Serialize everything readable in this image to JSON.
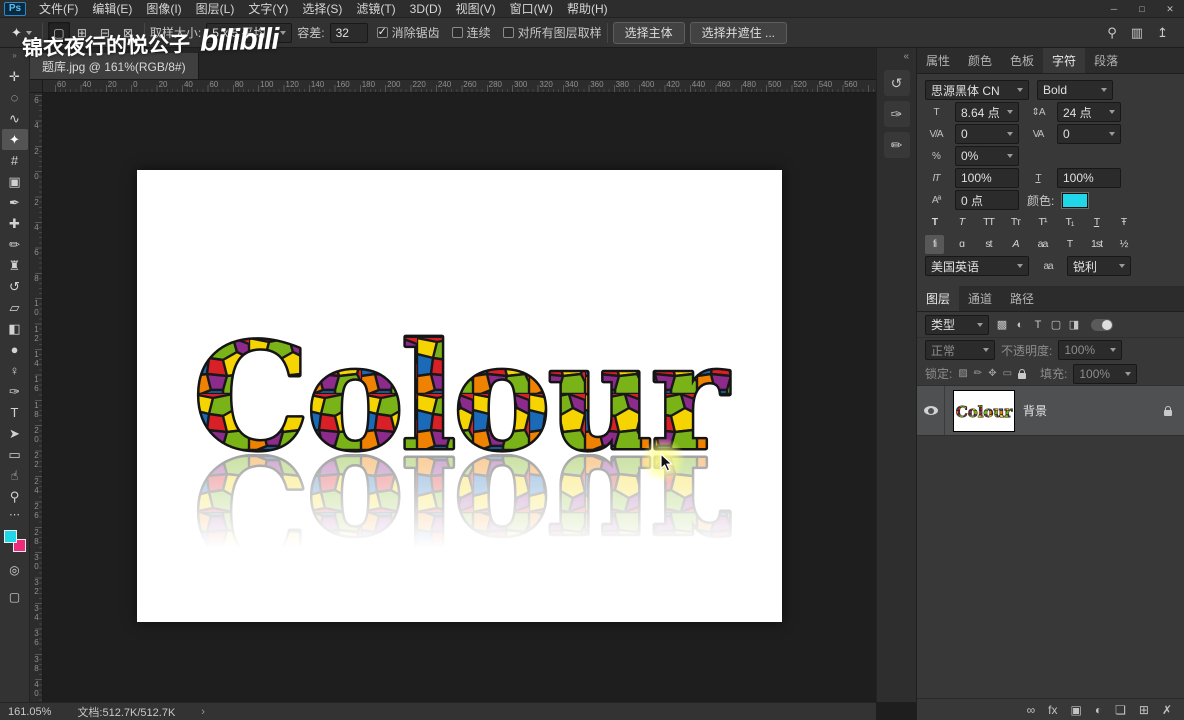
{
  "titlebar": {
    "logo": "Ps",
    "menus": [
      {
        "label": "文件(F)",
        "name": "menu-file"
      },
      {
        "label": "编辑(E)",
        "name": "menu-edit"
      },
      {
        "label": "图像(I)",
        "name": "menu-image"
      },
      {
        "label": "图层(L)",
        "name": "menu-layer"
      },
      {
        "label": "文字(Y)",
        "name": "menu-type"
      },
      {
        "label": "选择(S)",
        "name": "menu-select"
      },
      {
        "label": "滤镜(T)",
        "name": "menu-filter"
      },
      {
        "label": "3D(D)",
        "name": "menu-3d"
      },
      {
        "label": "视图(V)",
        "name": "menu-view"
      },
      {
        "label": "窗口(W)",
        "name": "menu-window"
      },
      {
        "label": "帮助(H)",
        "name": "menu-help"
      }
    ],
    "window_controls": [
      {
        "glyph": "─",
        "name": "minimize-button"
      },
      {
        "glyph": "□",
        "name": "maximize-button"
      },
      {
        "glyph": "✕",
        "name": "close-button"
      }
    ]
  },
  "options": {
    "tool_glyph": "✦",
    "modes": [
      {
        "glyph": "▢",
        "name": "new-selection-mode-button",
        "active": true
      },
      {
        "glyph": "⊞",
        "name": "add-to-selection-mode-button"
      },
      {
        "glyph": "⊟",
        "name": "subtract-from-selection-mode-button"
      },
      {
        "glyph": "⊠",
        "name": "intersect-selection-mode-button"
      }
    ],
    "sample_size_label": "取样大小:",
    "sample_size_value": "5 x 5 平均",
    "tolerance_label": "容差:",
    "tolerance_value": "32",
    "checkboxes": [
      {
        "label": "消除锯齿",
        "name": "anti-alias-checkbox",
        "checked": true
      },
      {
        "label": "连续",
        "name": "contiguous-checkbox",
        "checked": false
      },
      {
        "label": "对所有图层取样",
        "name": "sample-all-layers-checkbox",
        "checked": false
      }
    ],
    "select_subject": "选择主体",
    "select_and_mask": "选择并遮住 ...",
    "right_icons": [
      {
        "glyph": "⚲",
        "name": "search-icon"
      },
      {
        "glyph": "▥",
        "name": "workspace-switcher-icon"
      },
      {
        "glyph": "↥",
        "name": "share-image-icon"
      }
    ]
  },
  "watermark": {
    "cjk": "锦衣夜行的悦公子",
    "latin": "bilibili"
  },
  "document": {
    "tab_title": "题库.jpg @ 161%(RGB/8#)",
    "art_text": "Colour"
  },
  "rulers": {
    "h_labels": [
      "60",
      "40",
      "20",
      "0",
      "20",
      "40",
      "60",
      "80",
      "100",
      "120",
      "140",
      "160",
      "180",
      "200",
      "220",
      "240",
      "260",
      "280",
      "300",
      "320",
      "340",
      "360",
      "380",
      "400",
      "420",
      "440",
      "460",
      "480",
      "500",
      "520",
      "540",
      "560"
    ],
    "v_labels": [
      "6",
      "4",
      "2",
      "0",
      "2",
      "4",
      "6",
      "8",
      "10",
      "12",
      "14",
      "16",
      "18",
      "20",
      "22",
      "24",
      "26",
      "28",
      "30",
      "32",
      "34",
      "36",
      "38",
      "40"
    ]
  },
  "toolbar": {
    "grip": "»",
    "tools": [
      {
        "name": "move-tool",
        "glyph": "✛",
        "selected": false
      },
      {
        "name": "marquee-tool",
        "glyph": "◌",
        "selected": false
      },
      {
        "name": "lasso-tool",
        "glyph": "∿",
        "selected": false
      },
      {
        "name": "magic-wand-tool",
        "glyph": "✦",
        "selected": true
      },
      {
        "name": "crop-tool",
        "glyph": "#",
        "selected": false
      },
      {
        "name": "frame-tool",
        "glyph": "▣",
        "selected": false
      },
      {
        "name": "eyedropper-tool",
        "glyph": "✒",
        "selected": false
      },
      {
        "name": "healing-brush-tool",
        "glyph": "✚",
        "selected": false
      },
      {
        "name": "brush-tool",
        "glyph": "✏",
        "selected": false
      },
      {
        "name": "clone-stamp-tool",
        "glyph": "♜",
        "selected": false
      },
      {
        "name": "history-brush-tool",
        "glyph": "↺",
        "selected": false
      },
      {
        "name": "eraser-tool",
        "glyph": "▱",
        "selected": false
      },
      {
        "name": "gradient-tool",
        "glyph": "◧",
        "selected": false
      },
      {
        "name": "blur-tool",
        "glyph": "●",
        "selected": false
      },
      {
        "name": "dodge-tool",
        "glyph": "♀",
        "selected": false
      },
      {
        "name": "pen-tool",
        "glyph": "✑",
        "selected": false
      },
      {
        "name": "type-tool",
        "glyph": "T",
        "selected": false
      },
      {
        "name": "path-selection-tool",
        "glyph": "➤",
        "selected": false
      },
      {
        "name": "rectangle-tool",
        "glyph": "▭",
        "selected": false
      },
      {
        "name": "hand-tool",
        "glyph": "☝",
        "selected": false
      },
      {
        "name": "zoom-tool",
        "glyph": "⚲",
        "selected": false
      }
    ],
    "more_tools": "⋯",
    "fg_color": "#20d6e9",
    "bg_color": "#ee2a7b",
    "quick_mask_glyph": "◎",
    "screen_mode_glyph": "▢"
  },
  "strip": {
    "collapse": "«",
    "icons": [
      {
        "glyph": "↺",
        "name": "history-panel-icon"
      },
      {
        "glyph": "✑",
        "name": "brush-settings-panel-icon"
      },
      {
        "glyph": "✏",
        "name": "brush-panel-icon"
      }
    ]
  },
  "panels": {
    "panel_menu_glyph": "≡",
    "char_tabs": [
      {
        "label": "属性",
        "name": "tab-properties",
        "active": false
      },
      {
        "label": "颜色",
        "name": "tab-color",
        "active": false
      },
      {
        "label": "色板",
        "name": "tab-swatches",
        "active": false
      },
      {
        "label": "字符",
        "name": "tab-character",
        "active": true
      },
      {
        "label": "段落",
        "name": "tab-paragraph",
        "active": false
      }
    ],
    "character": {
      "font_family": "思源黑体 CN",
      "font_style": "Bold",
      "size_icon": "T",
      "size": "8.64 点",
      "leading_icon": "⇕A",
      "leading": "24 点",
      "kerning_icon": "V/A",
      "kerning": "0",
      "tracking_icon": "VA",
      "tracking": "0",
      "prop_icon": "%",
      "proportional": "0%",
      "vscale_icon": "IT",
      "vscale": "100%",
      "hscale_icon": "T",
      "hscale": "100%",
      "baseline_icon": "Aª",
      "baseline": "0 点",
      "color_label": "颜色:",
      "text_color": "#20d6e9",
      "style_buttons": [
        {
          "name": "faux-bold-button",
          "glyph": "T",
          "cls": "b"
        },
        {
          "name": "faux-italic-button",
          "glyph": "T",
          "cls": "i"
        },
        {
          "name": "all-caps-button",
          "glyph": "TT"
        },
        {
          "name": "small-caps-button",
          "glyph": "Tᴛ"
        },
        {
          "name": "superscript-button",
          "glyph": "T¹"
        },
        {
          "name": "subscript-button",
          "glyph": "T₁"
        },
        {
          "name": "underline-button",
          "glyph": "T",
          "cls": "u"
        },
        {
          "name": "strikethrough-button",
          "glyph": "Ŧ"
        }
      ],
      "opentype_buttons": [
        {
          "name": "standard-ligatures-button",
          "glyph": "fi",
          "active": true
        },
        {
          "name": "contextual-alternates-button",
          "glyph": "ɑ"
        },
        {
          "name": "discretionary-ligatures-button",
          "glyph": "st"
        },
        {
          "name": "swash-button",
          "glyph": "A",
          "cls": "i"
        },
        {
          "name": "stylistic-alternates-button",
          "glyph": "aa"
        },
        {
          "name": "titling-alternates-button",
          "glyph": "T"
        },
        {
          "name": "ordinals-button",
          "glyph": "1st"
        },
        {
          "name": "fractions-button",
          "glyph": "½"
        }
      ],
      "language": "美国英语",
      "aa_icon": "aa",
      "antialias": "锐利"
    },
    "layer_tabs": [
      {
        "label": "图层",
        "name": "tab-layers",
        "active": true
      },
      {
        "label": "通道",
        "name": "tab-channels",
        "active": false
      },
      {
        "label": "路径",
        "name": "tab-paths",
        "active": false
      }
    ],
    "layers": {
      "filter_label": "类型",
      "filter_icons": [
        {
          "glyph": "▩",
          "name": "filter-pixel-layers-icon"
        },
        {
          "glyph": "◐",
          "name": "filter-adjustment-layers-icon"
        },
        {
          "glyph": "T",
          "name": "filter-type-layers-icon"
        },
        {
          "glyph": "▢",
          "name": "filter-shape-layers-icon"
        },
        {
          "glyph": "◨",
          "name": "filter-smart-objects-icon"
        }
      ],
      "blend_mode": "正常",
      "opacity_label": "不透明度:",
      "opacity": "100%",
      "lock_label": "锁定:",
      "lock_icons": [
        {
          "glyph": "▨",
          "name": "lock-transparency-icon"
        },
        {
          "glyph": "✏",
          "name": "lock-pixels-icon"
        },
        {
          "glyph": "✥",
          "name": "lock-position-icon"
        },
        {
          "glyph": "▭",
          "name": "lock-artboard-icon"
        }
      ],
      "fill_label": "填充:",
      "fill": "100%",
      "layer_name": "背景",
      "bottom_icons": [
        {
          "glyph": "∞",
          "name": "link-layers-button"
        },
        {
          "glyph": "fx",
          "name": "layer-style-button"
        },
        {
          "glyph": "▣",
          "name": "add-layer-mask-button"
        },
        {
          "glyph": "◐",
          "name": "new-adjustment-layer-button"
        },
        {
          "glyph": "❏",
          "name": "new-group-button"
        },
        {
          "glyph": "⊞",
          "name": "new-layer-button"
        },
        {
          "glyph": "✗",
          "name": "delete-layer-button"
        }
      ]
    }
  },
  "statusbar": {
    "zoom": "161.05%",
    "doc_info": "文档:512.7K/512.7K",
    "chevron": "›"
  }
}
